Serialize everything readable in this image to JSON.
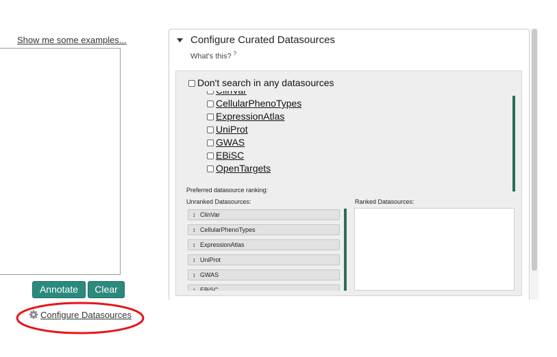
{
  "left": {
    "examples_link": "Show me some examples...",
    "textarea_value": "",
    "annotate_label": "Annotate",
    "clear_label": "Clear",
    "configure_label": "Configure Datasources"
  },
  "panel": {
    "title": "Configure Curated Datasources",
    "whats_this": "What's this?",
    "help_mark": "?",
    "dont_search_label": "Don't search in any datasources",
    "datasources": [
      "ClinVar",
      "CellularPhenoTypes",
      "ExpressionAtlas",
      "UniProt",
      "GWAS",
      "EBiSC",
      "OpenTargets"
    ],
    "preferred_label": "Preferred datasource ranking:",
    "unranked_label": "Unranked Datasources:",
    "ranked_label": "Ranked Datasources:",
    "unranked_items": [
      "ClinVar",
      "CellularPhenoTypes",
      "ExpressionAtlas",
      "UniProt",
      "GWAS",
      "EBiSC"
    ],
    "ranked_items": []
  },
  "colors": {
    "teal": "#2c8a7c",
    "scrollbar": "#2e6b5c",
    "highlight_ellipse": "#e8121a"
  }
}
